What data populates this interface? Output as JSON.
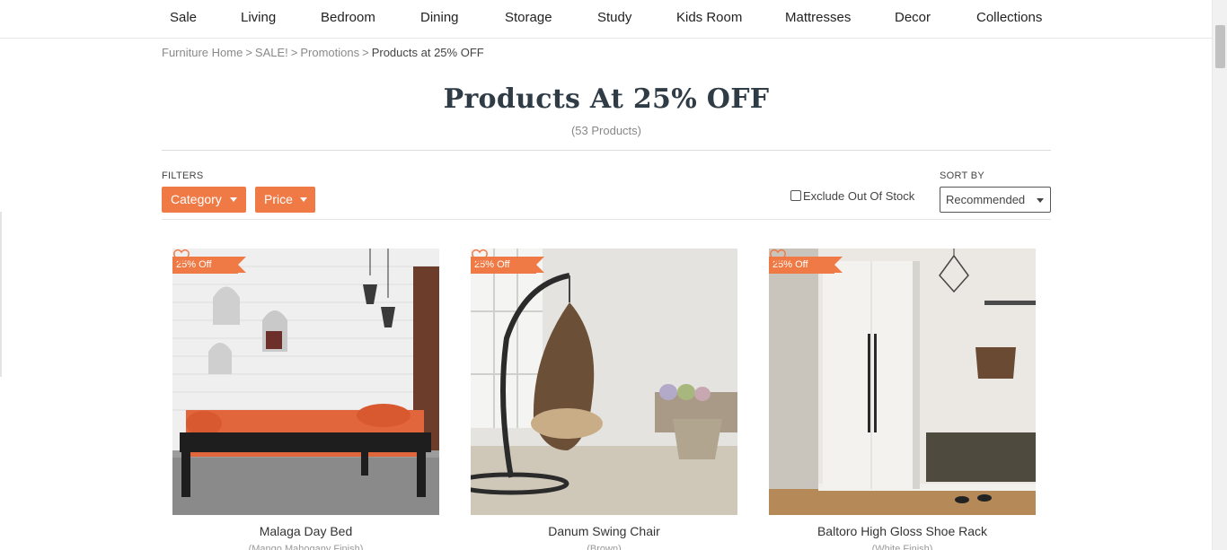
{
  "nav": {
    "items": [
      {
        "label": "Sale"
      },
      {
        "label": "Living"
      },
      {
        "label": "Bedroom"
      },
      {
        "label": "Dining"
      },
      {
        "label": "Storage"
      },
      {
        "label": "Study"
      },
      {
        "label": "Kids Room"
      },
      {
        "label": "Mattresses"
      },
      {
        "label": "Decor"
      },
      {
        "label": "Collections"
      }
    ]
  },
  "breadcrumb": {
    "items": [
      "Furniture Home",
      "SALE!",
      "Promotions"
    ],
    "separator": ">",
    "current": "Products at 25% OFF"
  },
  "page": {
    "title": "Products At 25% OFF",
    "count": "(53 Products)"
  },
  "filters": {
    "label": "FILTERS",
    "category_label": "Category",
    "price_label": "Price",
    "exclude_label": "Exclude Out Of Stock",
    "exclude_checked": false
  },
  "sort": {
    "label": "SORT BY",
    "selected": "Recommended"
  },
  "colors": {
    "accent": "#ef7a45",
    "title": "#2f3b45"
  },
  "products": [
    {
      "badge": "25% Off",
      "name": "Malaga Day Bed",
      "variant": "(Mango Mahogany Finish)",
      "wishlist_icon": "heart-outline-icon"
    },
    {
      "badge": "25% Off",
      "name": "Danum Swing Chair",
      "variant": "(Brown)",
      "wishlist_icon": "heart-outline-icon"
    },
    {
      "badge": "25% Off",
      "name": "Baltoro High Gloss Shoe Rack",
      "variant": "(White Finish)",
      "wishlist_icon": "heart-outline-icon"
    }
  ]
}
